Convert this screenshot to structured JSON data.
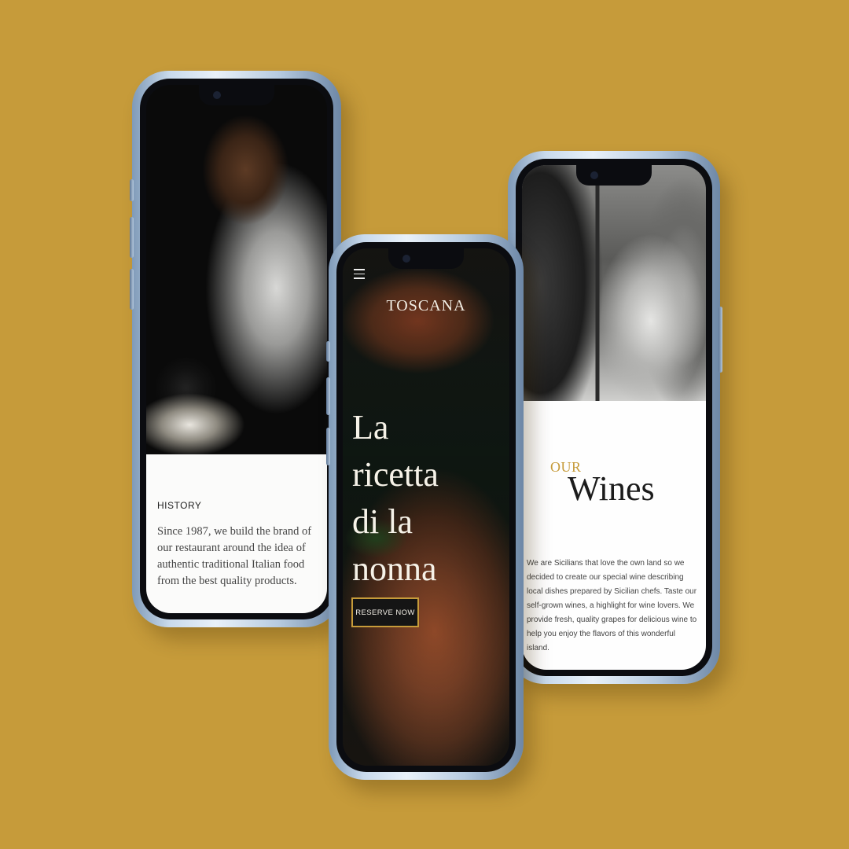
{
  "history_screen": {
    "section_label": "HISTORY",
    "body": "Since 1987, we build the brand of our restaurant around the idea of authentic traditional Italian food from the best quality products."
  },
  "hero_screen": {
    "brand": "TOSCANA",
    "title_line_1": "La",
    "title_line_2": "ricetta",
    "title_line_3": "di la",
    "title_line_4": "nonna",
    "cta_label": "RESERVE NOW"
  },
  "wines_screen": {
    "eyebrow": "OUR",
    "title": "Wines",
    "body": "We are Sicilians that love the own land so we decided to create our special wine describing local dishes prepared by Sicilian chefs. Taste our self-grown wines, a highlight for wine lovers. We provide fresh, quality grapes for delicious wine to help you enjoy the flavors of this wonderful island."
  },
  "colors": {
    "background": "#c69b3a",
    "accent_gold": "#c69b3a",
    "button_bg": "#151515"
  }
}
